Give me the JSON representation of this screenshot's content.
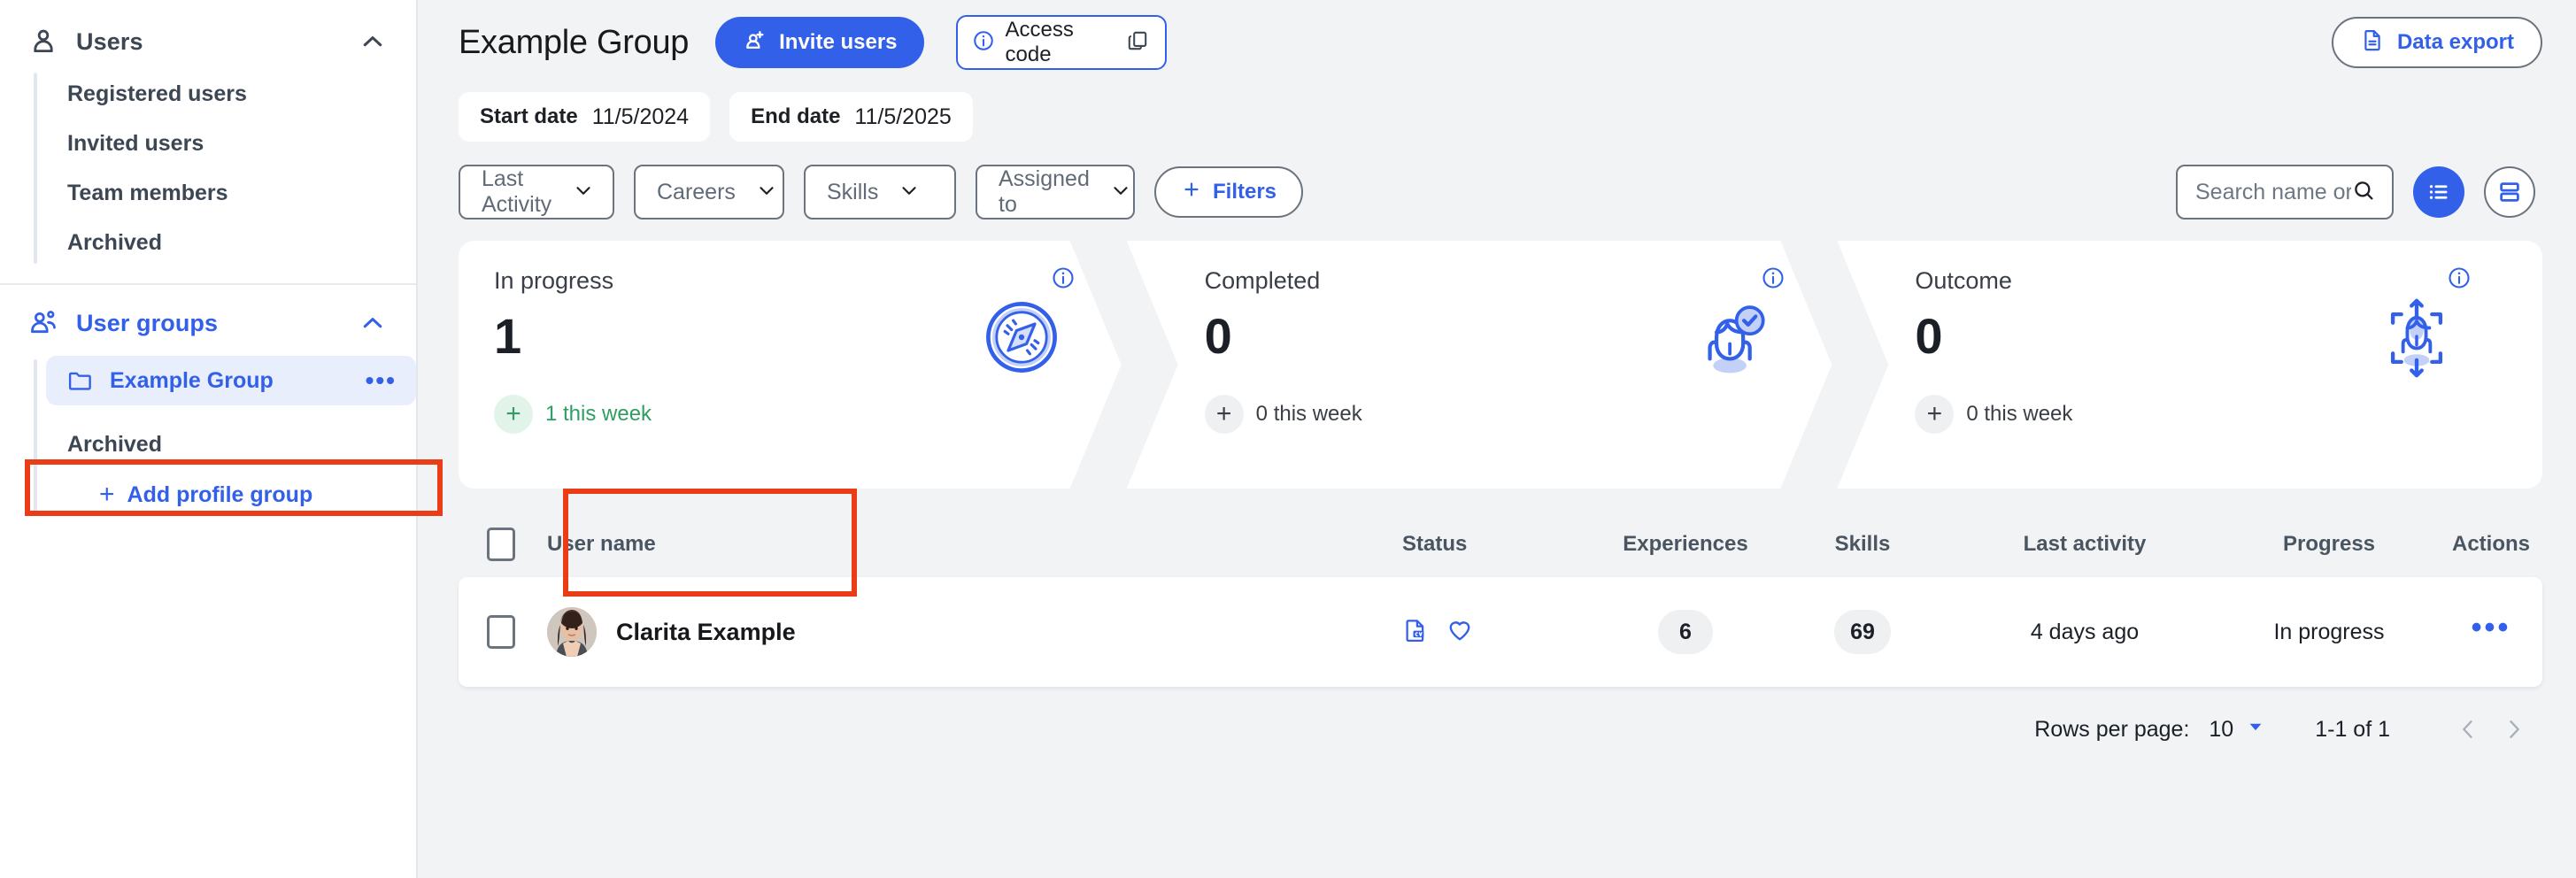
{
  "sidebar": {
    "sections": [
      {
        "id": "users",
        "label": "Users",
        "icon": "user-icon",
        "expanded": true,
        "items": [
          {
            "label": "Registered users"
          },
          {
            "label": "Invited users"
          },
          {
            "label": "Team members"
          },
          {
            "label": "Archived"
          }
        ]
      },
      {
        "id": "user-groups",
        "label": "User groups",
        "icon": "users-group-icon",
        "expanded": true,
        "items": [
          {
            "label": "Example Group",
            "active": true,
            "icon": "folder-icon",
            "menu": "•••"
          },
          {
            "label": "Archived",
            "active": false
          }
        ],
        "add_label": "Add profile group",
        "add_icon": "plus-icon"
      }
    ]
  },
  "header": {
    "title": "Example Group",
    "invite_button": "Invite users",
    "invite_icon": "add-user-icon",
    "access_code_label": "Access code",
    "access_code_info_icon": "info-icon",
    "access_code_copy_icon": "copy-icon",
    "export_button": "Data export",
    "export_icon": "document-icon"
  },
  "dates": {
    "start_label": "Start date",
    "start_value": "11/5/2024",
    "end_label": "End date",
    "end_value": "11/5/2025"
  },
  "filters": {
    "selects": [
      {
        "label": "Last Activity",
        "width": "sel-w1"
      },
      {
        "label": "Careers",
        "width": "sel-w2"
      },
      {
        "label": "Skills",
        "width": "sel-w3"
      },
      {
        "label": "Assigned to",
        "width": "sel-w4"
      }
    ],
    "filters_button": "Filters",
    "filters_icon": "plus-icon",
    "search_placeholder": "Search name or email",
    "search_value": "",
    "search_icon": "search-icon",
    "view_list_icon": "list-view-icon",
    "view_card_icon": "card-view-icon"
  },
  "stat_cards": [
    {
      "id": "in-progress",
      "title": "In progress",
      "value": "1",
      "sub_text": "1 this week",
      "sub_tone": "green",
      "art_icon": "compass-icon",
      "info_icon": "info-icon"
    },
    {
      "id": "completed",
      "title": "Completed",
      "value": "0",
      "sub_text": "0 this week",
      "sub_tone": "grey",
      "art_icon": "person-check-icon",
      "info_icon": "info-icon"
    },
    {
      "id": "outcome",
      "title": "Outcome",
      "value": "0",
      "sub_text": "0 this week",
      "sub_tone": "grey",
      "art_icon": "person-expand-icon",
      "info_icon": "info-icon"
    }
  ],
  "table": {
    "columns": [
      "User name",
      "Status",
      "Experiences",
      "Skills",
      "Last activity",
      "Progress",
      "Actions"
    ],
    "rows": [
      {
        "selected": false,
        "name": "Clarita Example",
        "avatar": "user-photo",
        "status_icons": [
          "cv-document-icon",
          "heart-icon"
        ],
        "experiences": "6",
        "skills": "69",
        "last_activity": "4 days ago",
        "progress": "In progress",
        "actions_icon": "more-actions-icon"
      }
    ]
  },
  "pagination": {
    "rows_label": "Rows per page:",
    "rows_value": "10",
    "rows_chevron_icon": "chevron-down-icon",
    "range": "1-1 of 1",
    "prev_icon": "chevron-left-icon",
    "next_icon": "chevron-right-icon"
  },
  "colors": {
    "accent": "#3360e8",
    "annotation": "#ea3c16",
    "success": "#2e9e63",
    "page_bg": "#f1f3f5"
  }
}
